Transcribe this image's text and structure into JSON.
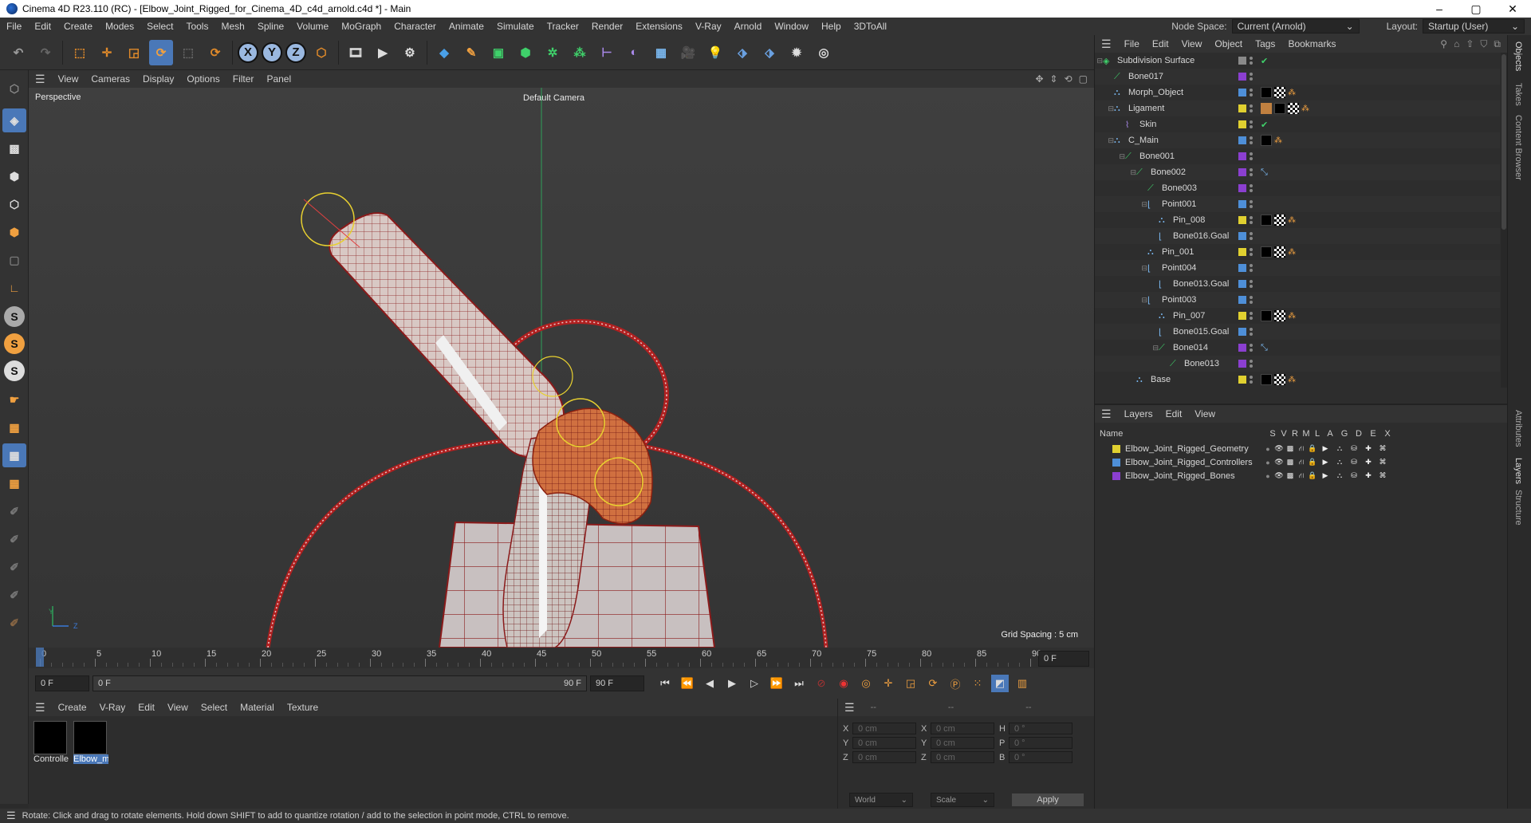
{
  "window": {
    "title": "Cinema 4D R23.110 (RC) - [Elbow_Joint_Rigged_for_Cinema_4D_c4d_arnold.c4d *] - Main",
    "minimize": "–",
    "maximize": "▢",
    "close": "✕"
  },
  "menubar": {
    "items": [
      "File",
      "Edit",
      "Create",
      "Modes",
      "Select",
      "Tools",
      "Mesh",
      "Spline",
      "Volume",
      "MoGraph",
      "Character",
      "Animate",
      "Simulate",
      "Tracker",
      "Render",
      "Extensions",
      "V-Ray",
      "Arnold",
      "Window",
      "Help",
      "3DToAll"
    ],
    "node_space_label": "Node Space:",
    "node_space_value": "Current (Arnold)",
    "layout_label": "Layout:",
    "layout_value": "Startup (User)"
  },
  "viewport": {
    "menu": [
      "View",
      "Cameras",
      "Display",
      "Options",
      "Filter",
      "Panel"
    ],
    "name": "Perspective",
    "camera": "Default Camera",
    "grid_spacing": "Grid Spacing : 5 cm",
    "axis_y": "Y",
    "axis_z": "Z"
  },
  "timeline": {
    "ticks": [
      "0",
      "5",
      "10",
      "15",
      "20",
      "25",
      "30",
      "35",
      "40",
      "45",
      "50",
      "55",
      "60",
      "65",
      "70",
      "75",
      "80",
      "85",
      "90"
    ],
    "current_frame": "0 F"
  },
  "playback": {
    "start": "0 F",
    "slider_start": "0 F",
    "slider_end": "90 F",
    "end": "90 F"
  },
  "material_panel": {
    "menu": [
      "Create",
      "V-Ray",
      "Edit",
      "View",
      "Select",
      "Material",
      "Texture"
    ],
    "materials": [
      {
        "label": "Controlle",
        "selected": false
      },
      {
        "label": "Elbow_m",
        "selected": true
      }
    ]
  },
  "coord_panel": {
    "headers": [
      "--",
      "--",
      "--"
    ],
    "rows": [
      {
        "a": "X",
        "av": "0 cm",
        "b": "X",
        "bv": "0 cm",
        "c": "H",
        "cv": "0 °"
      },
      {
        "a": "Y",
        "av": "0 cm",
        "b": "Y",
        "bv": "0 cm",
        "c": "P",
        "cv": "0 °"
      },
      {
        "a": "Z",
        "av": "0 cm",
        "b": "Z",
        "bv": "0 cm",
        "c": "B",
        "cv": "0 °"
      }
    ],
    "mode1": "World",
    "mode2": "Scale",
    "apply": "Apply"
  },
  "object_manager": {
    "menu": [
      "File",
      "Edit",
      "View",
      "Object",
      "Tags",
      "Bookmarks"
    ],
    "objects": [
      {
        "name": "Subdivision Surface",
        "indent": 0,
        "color": "#8a8a8a",
        "icon": "subdivision-icon",
        "tags": "check"
      },
      {
        "name": "Bone017",
        "indent": 1,
        "color": "#8b3fd0",
        "icon": "bone-icon",
        "tags": ""
      },
      {
        "name": "Morph_Object",
        "indent": 1,
        "color": "#4e8fd8",
        "icon": "null-icon",
        "tags": "mat"
      },
      {
        "name": "Ligament",
        "indent": 1,
        "color": "#e0d030",
        "icon": "null-icon",
        "tags": "mat2"
      },
      {
        "name": "Skin",
        "indent": 2,
        "color": "#e0d030",
        "icon": "skin-icon",
        "tags": "check"
      },
      {
        "name": "C_Main",
        "indent": 1,
        "color": "#4e8fd8",
        "icon": "null-icon",
        "tags": "matsmall"
      },
      {
        "name": "Bone001",
        "indent": 2,
        "color": "#8b3fd0",
        "icon": "bone-icon",
        "tags": ""
      },
      {
        "name": "Bone002",
        "indent": 3,
        "color": "#8b3fd0",
        "icon": "bone-icon",
        "tags": "ik"
      },
      {
        "name": "Bone003",
        "indent": 4,
        "color": "#8b3fd0",
        "icon": "bone-icon",
        "tags": ""
      },
      {
        "name": "Point001",
        "indent": 4,
        "color": "#4e8fd8",
        "icon": "point-icon",
        "tags": ""
      },
      {
        "name": "Pin_008",
        "indent": 5,
        "color": "#e0d030",
        "icon": "null-icon",
        "tags": "mat"
      },
      {
        "name": "Bone016.Goal",
        "indent": 5,
        "color": "#4e8fd8",
        "icon": "point-icon",
        "tags": ""
      },
      {
        "name": "Pin_001",
        "indent": 4,
        "color": "#e0d030",
        "icon": "null-icon",
        "tags": "mat"
      },
      {
        "name": "Point004",
        "indent": 4,
        "color": "#4e8fd8",
        "icon": "point-icon",
        "tags": ""
      },
      {
        "name": "Bone013.Goal",
        "indent": 5,
        "color": "#4e8fd8",
        "icon": "point-icon",
        "tags": ""
      },
      {
        "name": "Point003",
        "indent": 4,
        "color": "#4e8fd8",
        "icon": "point-icon",
        "tags": ""
      },
      {
        "name": "Pin_007",
        "indent": 5,
        "color": "#e0d030",
        "icon": "null-icon",
        "tags": "mat"
      },
      {
        "name": "Bone015.Goal",
        "indent": 5,
        "color": "#4e8fd8",
        "icon": "point-icon",
        "tags": ""
      },
      {
        "name": "Bone014",
        "indent": 5,
        "color": "#8b3fd0",
        "icon": "bone-icon",
        "tags": "ik"
      },
      {
        "name": "Bone013",
        "indent": 6,
        "color": "#8b3fd0",
        "icon": "bone-icon",
        "tags": ""
      },
      {
        "name": "Base",
        "indent": 3,
        "color": "#e0d030",
        "icon": "null-icon",
        "tags": "mat"
      }
    ]
  },
  "layer_manager": {
    "menu": [
      "Layers",
      "Edit",
      "View"
    ],
    "col_name": "Name",
    "cols": [
      "S",
      "V",
      "R",
      "M",
      "L",
      "A",
      "G",
      "D",
      "E",
      "X"
    ],
    "layers": [
      {
        "name": "Elbow_Joint_Rigged_Geometry",
        "color": "#e0d030"
      },
      {
        "name": "Elbow_Joint_Rigged_Controllers",
        "color": "#4e8fd8"
      },
      {
        "name": "Elbow_Joint_Rigged_Bones",
        "color": "#8b3fd0"
      }
    ]
  },
  "side_tabs": [
    "Objects",
    "Takes",
    "Content Browser",
    "Attributes",
    "Layers",
    "Structure"
  ],
  "status": "Rotate: Click and drag to rotate elements. Hold down SHIFT to add to quantize rotation / add to the selection in point mode, CTRL to remove."
}
